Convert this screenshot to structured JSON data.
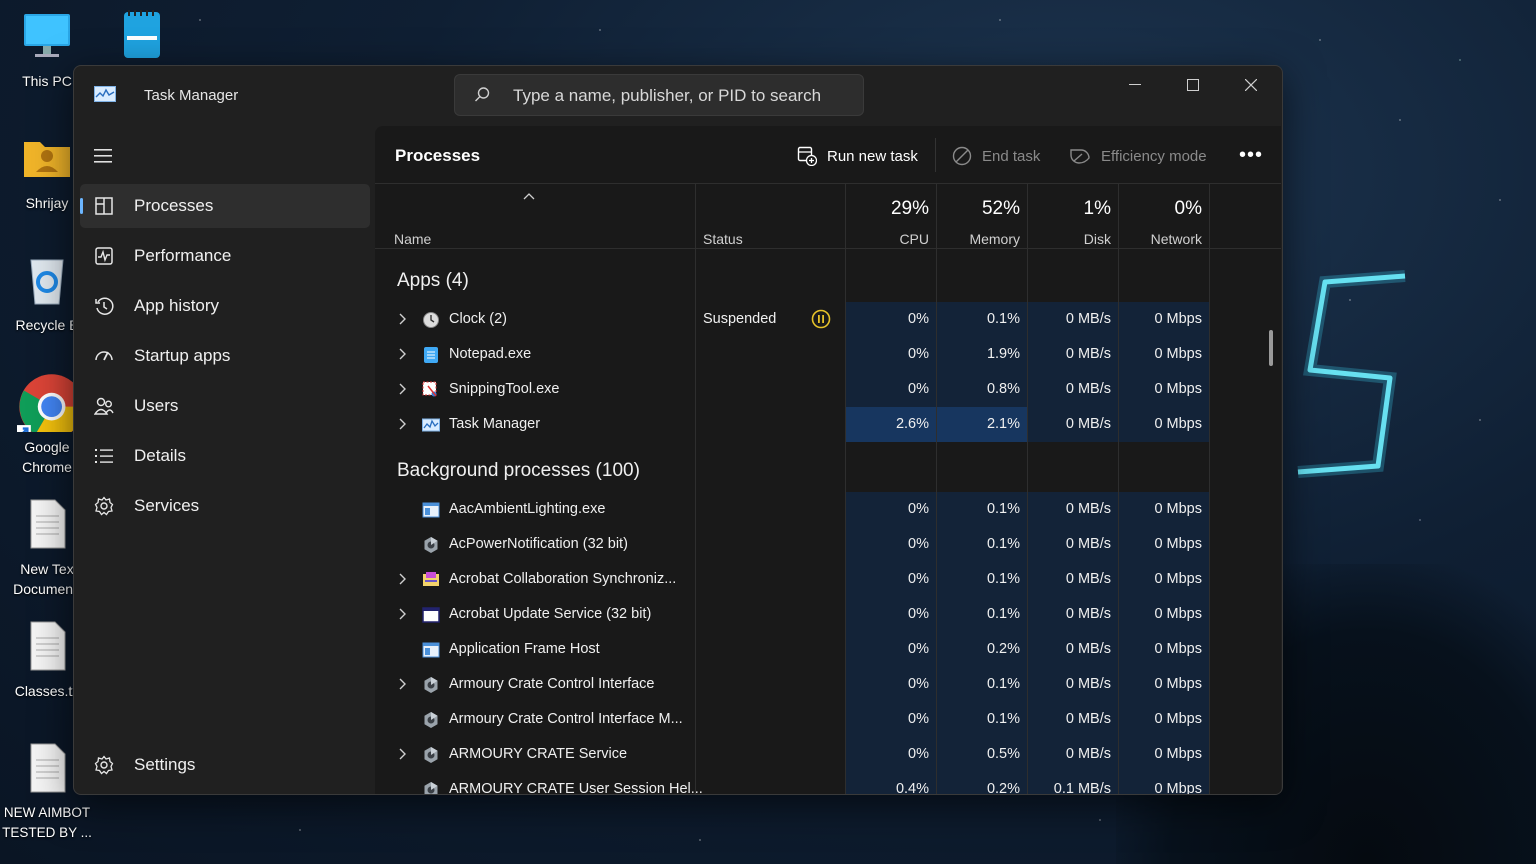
{
  "desktop": {
    "icons": [
      {
        "label": "This PC"
      },
      {
        "label": "Shrijay"
      },
      {
        "label": "Recycle B"
      },
      {
        "label": "Google Chrome"
      },
      {
        "label": "New Tex Document."
      },
      {
        "label": "Classes.tx"
      },
      {
        "label": "NEW AIMBOT TESTED BY ..."
      }
    ]
  },
  "window": {
    "title": "Task Manager",
    "search_placeholder": "Type a name, publisher, or PID to search"
  },
  "sidebar": {
    "items": [
      {
        "label": "Processes",
        "icon": "processes-icon",
        "active": true
      },
      {
        "label": "Performance",
        "icon": "performance-icon"
      },
      {
        "label": "App history",
        "icon": "app-history-icon"
      },
      {
        "label": "Startup apps",
        "icon": "startup-apps-icon"
      },
      {
        "label": "Users",
        "icon": "users-icon"
      },
      {
        "label": "Details",
        "icon": "details-icon"
      },
      {
        "label": "Services",
        "icon": "services-icon"
      }
    ],
    "settings_label": "Settings"
  },
  "toolbar": {
    "title": "Processes",
    "run_new_task": "Run new task",
    "end_task": "End task",
    "efficiency_mode": "Efficiency mode",
    "more": "•••"
  },
  "columns": {
    "name": "Name",
    "status": "Status",
    "cpu_pct": "29%",
    "cpu": "CPU",
    "memory_pct": "52%",
    "memory": "Memory",
    "disk_pct": "1%",
    "disk": "Disk",
    "network_pct": "0%",
    "network": "Network"
  },
  "groups": {
    "apps": "Apps (4)",
    "background": "Background processes (100)"
  },
  "apps": [
    {
      "name": "Clock (2)",
      "icon": "clock-icon",
      "expand": true,
      "status": "Suspended",
      "cpu": "0%",
      "memory": "0.1%",
      "disk": "0 MB/s",
      "network": "0 Mbps"
    },
    {
      "name": "Notepad.exe",
      "icon": "notepad-icon",
      "expand": true,
      "status": "",
      "cpu": "0%",
      "memory": "1.9%",
      "disk": "0 MB/s",
      "network": "0 Mbps"
    },
    {
      "name": "SnippingTool.exe",
      "icon": "snipping-tool-icon",
      "expand": true,
      "status": "",
      "cpu": "0%",
      "memory": "0.8%",
      "disk": "0 MB/s",
      "network": "0 Mbps"
    },
    {
      "name": "Task Manager",
      "icon": "task-manager-icon",
      "expand": true,
      "status": "",
      "cpu": "2.6%",
      "memory": "2.1%",
      "disk": "0 MB/s",
      "network": "0 Mbps",
      "highlight": true
    }
  ],
  "background": [
    {
      "name": "AacAmbientLighting.exe",
      "icon": "window-app-icon",
      "expand": false,
      "cpu": "0%",
      "memory": "0.1%",
      "disk": "0 MB/s",
      "network": "0 Mbps"
    },
    {
      "name": "AcPowerNotification (32 bit)",
      "icon": "asus-gear-icon",
      "expand": false,
      "cpu": "0%",
      "memory": "0.1%",
      "disk": "0 MB/s",
      "network": "0 Mbps"
    },
    {
      "name": "Acrobat Collaboration Synchroniz...",
      "icon": "acrobat-collab-icon",
      "expand": true,
      "cpu": "0%",
      "memory": "0.1%",
      "disk": "0 MB/s",
      "network": "0 Mbps"
    },
    {
      "name": "Acrobat Update Service (32 bit)",
      "icon": "blank-window-icon",
      "expand": true,
      "cpu": "0%",
      "memory": "0.1%",
      "disk": "0 MB/s",
      "network": "0 Mbps"
    },
    {
      "name": "Application Frame Host",
      "icon": "window-app-icon",
      "expand": false,
      "cpu": "0%",
      "memory": "0.2%",
      "disk": "0 MB/s",
      "network": "0 Mbps"
    },
    {
      "name": "Armoury Crate Control Interface",
      "icon": "asus-gear-icon",
      "expand": true,
      "cpu": "0%",
      "memory": "0.1%",
      "disk": "0 MB/s",
      "network": "0 Mbps"
    },
    {
      "name": "Armoury Crate Control Interface M...",
      "icon": "asus-gear-icon",
      "expand": false,
      "cpu": "0%",
      "memory": "0.1%",
      "disk": "0 MB/s",
      "network": "0 Mbps"
    },
    {
      "name": "ARMOURY CRATE Service",
      "icon": "asus-gear-icon",
      "expand": true,
      "cpu": "0%",
      "memory": "0.5%",
      "disk": "0 MB/s",
      "network": "0 Mbps"
    },
    {
      "name": "ARMOURY CRATE User Session Hel...",
      "icon": "asus-gear-icon",
      "expand": false,
      "cpu": "0.4%",
      "memory": "0.2%",
      "disk": "0.1 MB/s",
      "network": "0 Mbps"
    }
  ]
}
